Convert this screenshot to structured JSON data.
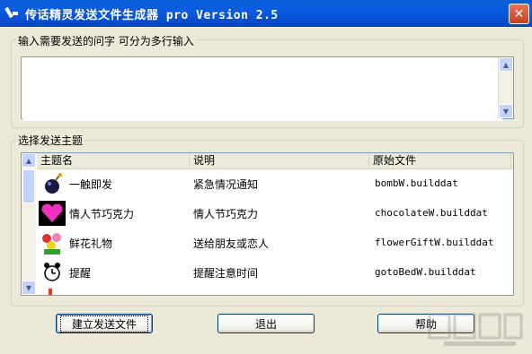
{
  "window": {
    "title": "传话精灵发送文件生成器 pro Version 2.5",
    "close_symbol": "✕"
  },
  "message_group": {
    "label": "输入需要发送的问字 可分为多行输入",
    "value": "",
    "placeholder": ""
  },
  "topic_group": {
    "label": "选择发送主题",
    "columns": [
      "主题名",
      "说明",
      "原始文件"
    ],
    "rows": [
      {
        "icon": "bomb-icon",
        "name": "一触即发",
        "desc": "紧急情况通知",
        "file": "bombW.builddat"
      },
      {
        "icon": "heart-icon",
        "name": "情人节巧克力",
        "desc": "情人节巧克力",
        "file": "chocolateW.builddat"
      },
      {
        "icon": "flower-icon",
        "name": "鲜花礼物",
        "desc": "送给朋友或恋人",
        "file": "flowerGiftW.builddat"
      },
      {
        "icon": "alarm-clock-icon",
        "name": "提醒",
        "desc": "提醒注意时间",
        "file": "gotoBedW.builddat"
      }
    ]
  },
  "buttons": {
    "create": "建立发送文件",
    "exit": "退出",
    "help": "帮助"
  },
  "colors": {
    "titlebar": "#0A5FD8",
    "window_bg": "#ECE9D8",
    "close": "#C8401E"
  }
}
